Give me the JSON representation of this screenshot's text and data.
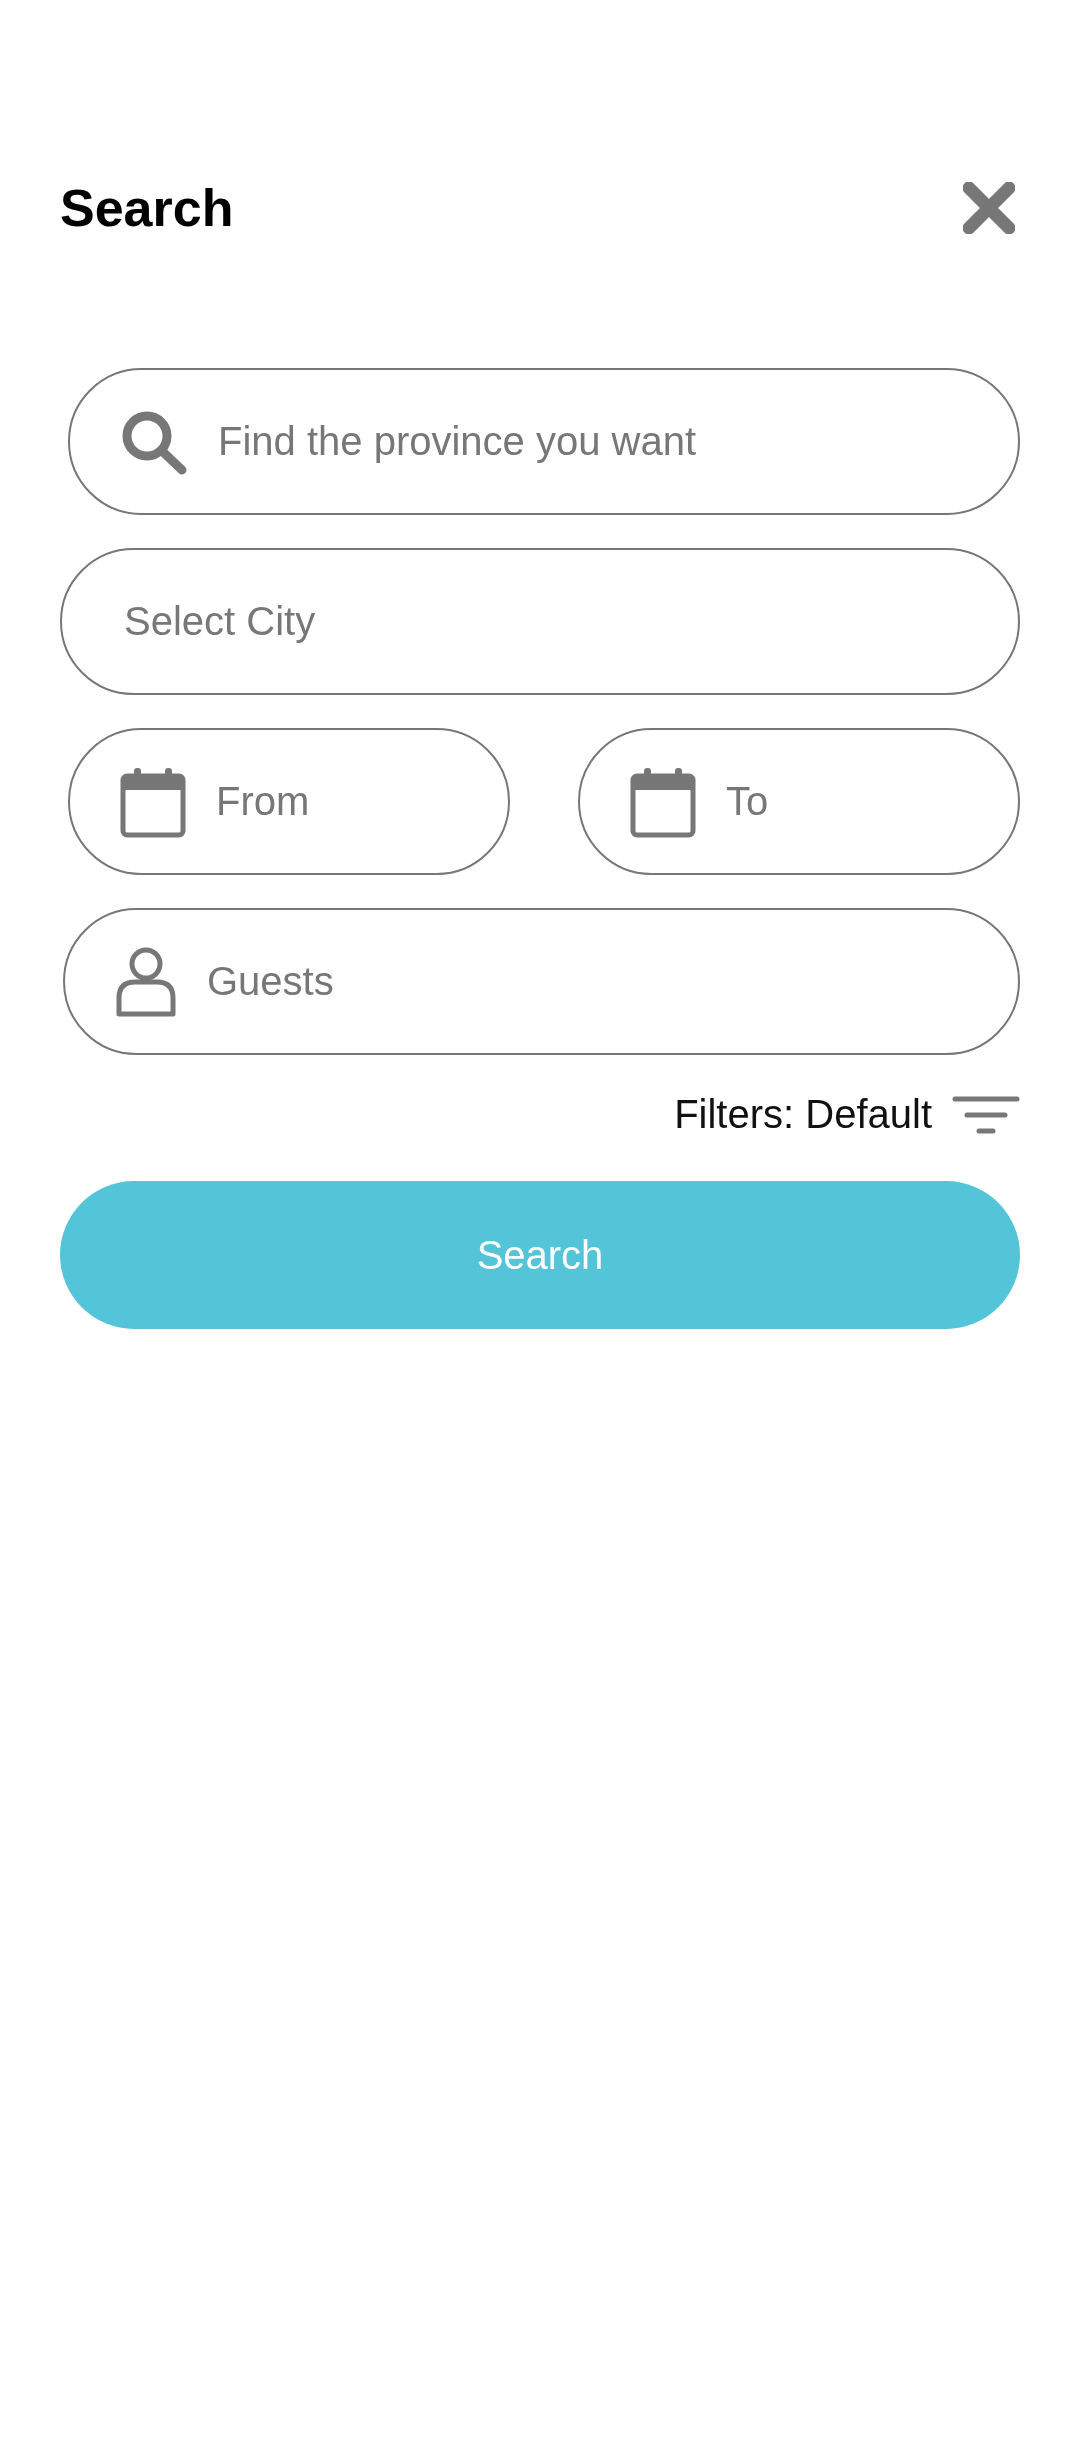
{
  "header": {
    "title": "Search"
  },
  "fields": [
    {
      "kind": "search",
      "placeholder": "Find the province you want"
    },
    {
      "kind": "plain",
      "placeholder": "Select City"
    }
  ],
  "dates": [
    {
      "kind": "date",
      "placeholder": "From"
    },
    {
      "kind": "date",
      "placeholder": "To"
    }
  ],
  "guests": {
    "kind": "person",
    "placeholder": "Guests"
  },
  "filters": {
    "label": "Filters: Default"
  },
  "search_button": {
    "label": "Search"
  }
}
